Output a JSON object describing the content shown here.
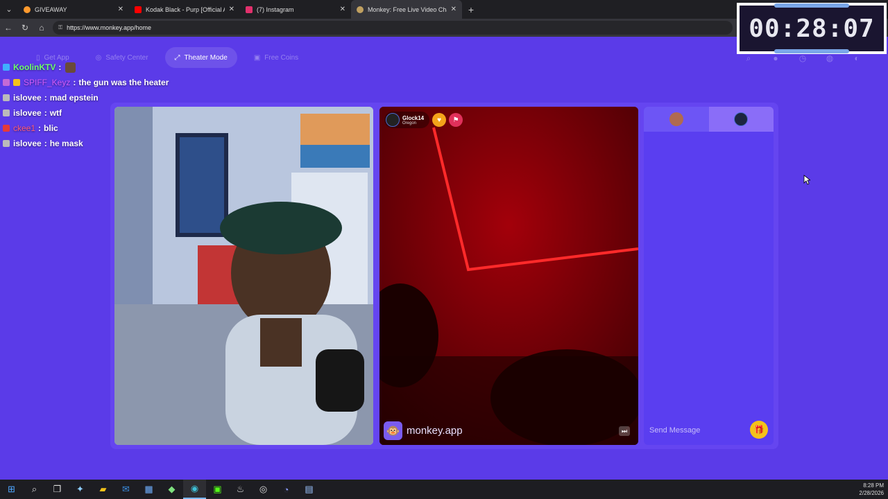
{
  "browser": {
    "tabs": [
      {
        "title": "GIVEAWAY",
        "color": "#ff9a2e"
      },
      {
        "title": "Kodak Black - Purp [Official Audio]",
        "color": "#ff0000"
      },
      {
        "title": "(7) Instagram",
        "color": "#e1306c"
      },
      {
        "title": "Monkey: Free Live Video Chat",
        "color": "#c0a060"
      }
    ],
    "url": "https://www.monkey.app/home"
  },
  "timer": {
    "time": "00:28:07"
  },
  "site_nav": {
    "get_app": "Get App",
    "safety_center": "Safety Center",
    "theater_mode": "Theater Mode",
    "free_coins": "Free Coins"
  },
  "chat_overlay": [
    {
      "user": "KoolinKTV",
      "user_color": "#6dff6d",
      "message": ""
    },
    {
      "user": "SPIFF_Keyz",
      "user_color": "#d65cff",
      "message": "the gun was the heater"
    },
    {
      "user": "islovee",
      "user_color": "#ffffff",
      "message": "mad epstein"
    },
    {
      "user": "islovee",
      "user_color": "#ffffff",
      "message": "wtf"
    },
    {
      "user": "ckee1",
      "user_color": "#ff5b7a",
      "message": "blic"
    },
    {
      "user": "islovee",
      "user_color": "#ffffff",
      "message": "he mask"
    }
  ],
  "partner": {
    "name": "Glock14",
    "location": "Oregon"
  },
  "brand": {
    "name": "monkey.app"
  },
  "chat_panel": {
    "send_placeholder": "Send Message"
  },
  "taskbar": {
    "time": "8:28 PM",
    "date": "2/28/2026"
  }
}
